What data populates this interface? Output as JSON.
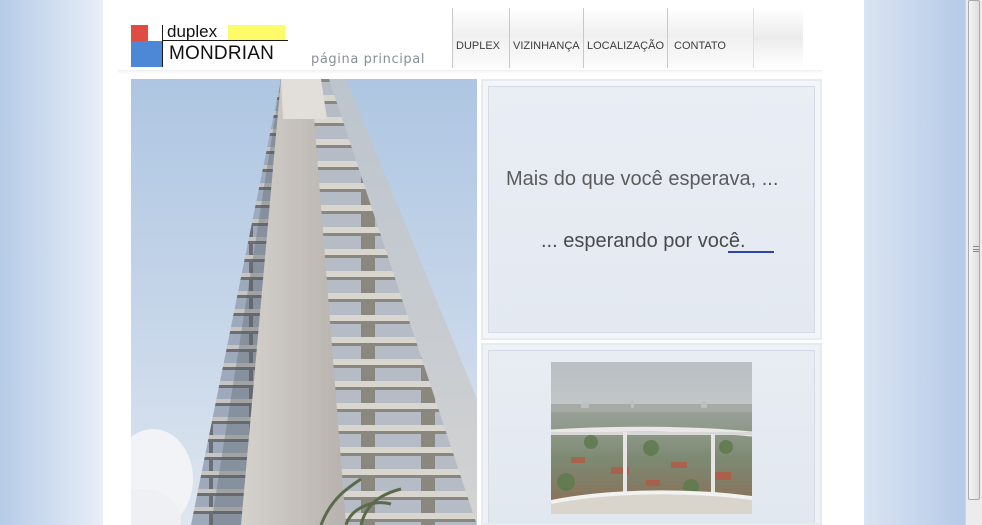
{
  "site": {
    "logo_top": "duplex",
    "logo_bottom": "MONDRIAN",
    "page_label": "página principal"
  },
  "nav": {
    "items": [
      {
        "label": "DUPLEX"
      },
      {
        "label": "VIZINHANÇA"
      },
      {
        "label": "LOCALIZAÇÃO"
      },
      {
        "label": "CONTATO"
      }
    ]
  },
  "main": {
    "tagline_1": "Mais do que você esperava, ...",
    "tagline_2": "... esperando por você."
  },
  "colors": {
    "logo_red": "#e04b43",
    "logo_blue": "#4d88d6",
    "logo_yellow": "#fdfb6a",
    "link_underline": "#2c45a6"
  }
}
